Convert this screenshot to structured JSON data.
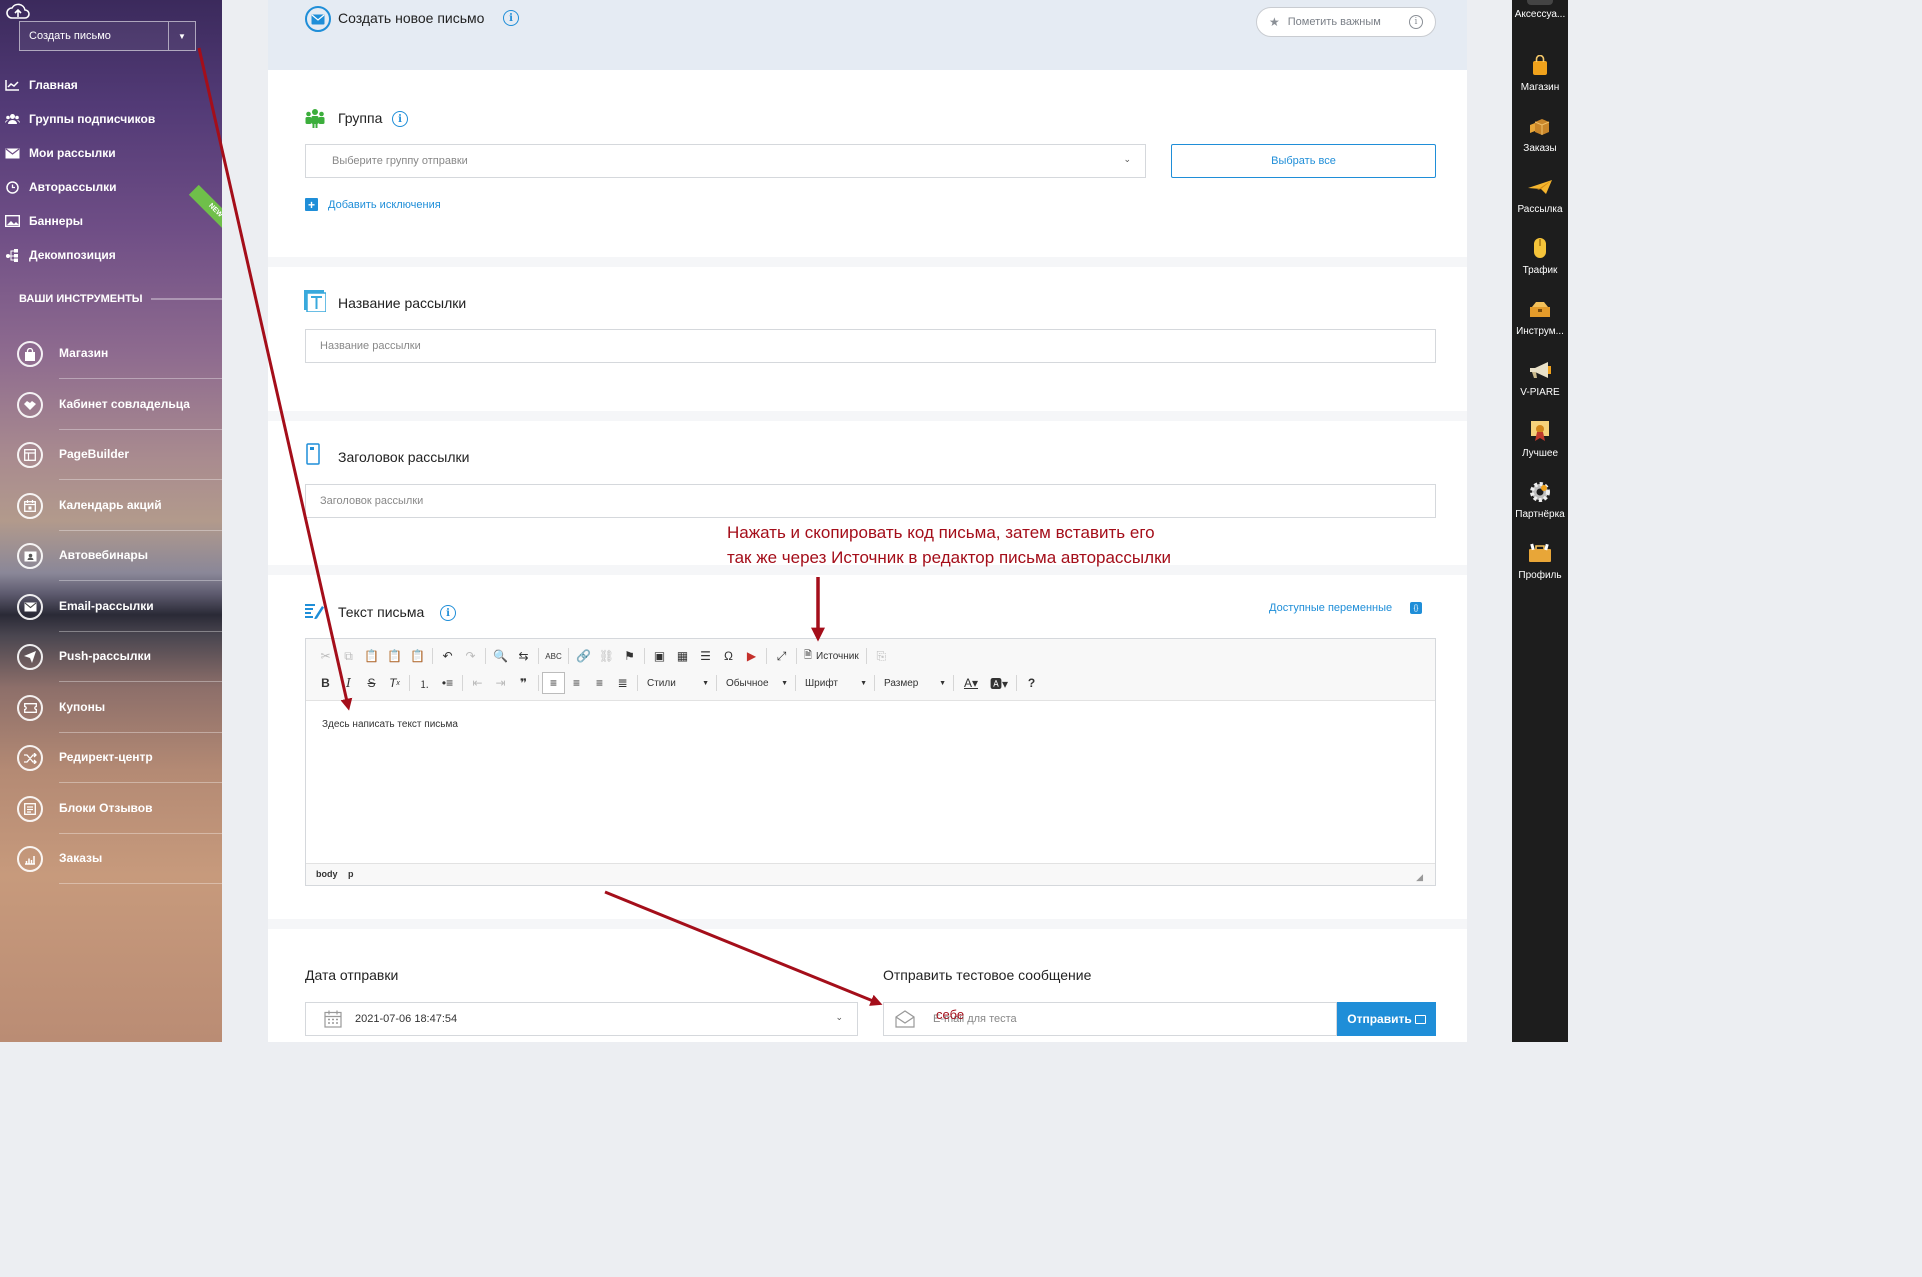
{
  "sidebar": {
    "create_button": "Создать письмо",
    "nav": [
      {
        "label": "Главная",
        "icon": "chart-line-icon"
      },
      {
        "label": "Группы подписчиков",
        "icon": "users-icon"
      },
      {
        "label": "Мои рассылки",
        "icon": "envelope-icon"
      },
      {
        "label": "Авторассылки",
        "icon": "clock-icon"
      },
      {
        "label": "Баннеры",
        "icon": "image-icon"
      },
      {
        "label": "Декомпозиция",
        "icon": "share-nodes-icon"
      }
    ],
    "new_badge": "NEW",
    "tools_title": "ВАШИ ИНСТРУМЕНТЫ",
    "tools": [
      {
        "label": "Магазин",
        "icon": "shopping-bag-icon"
      },
      {
        "label": "Кабинет совладельца",
        "icon": "handshake-icon"
      },
      {
        "label": "PageBuilder",
        "icon": "layout-icon"
      },
      {
        "label": "Календарь акций",
        "icon": "calendar-icon"
      },
      {
        "label": "Автовебинары",
        "icon": "webinar-icon"
      },
      {
        "label": "Email-рассылки",
        "icon": "envelope-icon"
      },
      {
        "label": "Push-рассылки",
        "icon": "paper-plane-icon"
      },
      {
        "label": "Купоны",
        "icon": "coupon-icon"
      },
      {
        "label": "Редирект-центр",
        "icon": "shuffle-icon"
      },
      {
        "label": "Блоки Отзывов",
        "icon": "reviews-icon"
      },
      {
        "label": "Заказы",
        "icon": "orders-icon"
      }
    ]
  },
  "header": {
    "title": "Создать новое письмо",
    "mark_important": "Пометить важным"
  },
  "group": {
    "title": "Группа",
    "select_placeholder": "Выберите группу отправки",
    "select_all": "Выбрать все",
    "add_exceptions": "Добавить исключения"
  },
  "mailing_name": {
    "title": "Название рассылки",
    "placeholder": "Название рассылки"
  },
  "mailing_subject": {
    "title": "Заголовок рассылки",
    "placeholder": "Заголовок рассылки"
  },
  "annotation": {
    "line1": "Нажать и скопировать код письма, затем вставить его",
    "line2": "так же через Источник в редактор письма авторассылки"
  },
  "letter": {
    "title": "Текст письма",
    "vars_link": "Доступные переменные",
    "vars_badge": "{}",
    "toolbar": {
      "source": "Источник",
      "styles": "Стили",
      "format": "Обычное",
      "font": "Шрифт",
      "size": "Размер"
    },
    "body_text": "Здесь написать текст письма",
    "path": [
      "body",
      "p"
    ]
  },
  "send_date": {
    "title": "Дата отправки",
    "value": "2021-07-06 18:47:54"
  },
  "test_message": {
    "title": "Отправить тестовое сообщение",
    "placeholder": "E-mail для теста",
    "send_button": "Отправить",
    "annotation": "себе"
  },
  "dock": [
    {
      "label": "Аксессуа...",
      "icon": "accessories-icon"
    },
    {
      "label": "Магазин",
      "icon": "shopping-bag-icon",
      "color": "#f0a21c"
    },
    {
      "label": "Заказы",
      "icon": "boxes-icon",
      "color": "#e8a638"
    },
    {
      "label": "Рассылка",
      "icon": "paper-plane-icon",
      "color": "#f5b52e"
    },
    {
      "label": "Трафик",
      "icon": "mouse-icon",
      "color": "#f5c43a"
    },
    {
      "label": "Инструм...",
      "icon": "toolbox-icon",
      "color": "#e49b2a"
    },
    {
      "label": "V-PIARE",
      "icon": "megaphone-icon",
      "color": "#e8e0c8"
    },
    {
      "label": "Лучшее",
      "icon": "certificate-icon",
      "color": "#f0a21c"
    },
    {
      "label": "Партнёрка",
      "icon": "gear-icon",
      "color": "#e6e6e6"
    },
    {
      "label": "Профиль",
      "icon": "briefcase-icon",
      "color": "#e8a638"
    }
  ],
  "colors": {
    "accent": "#1f8ed8",
    "annotation": "#a40e1a"
  }
}
